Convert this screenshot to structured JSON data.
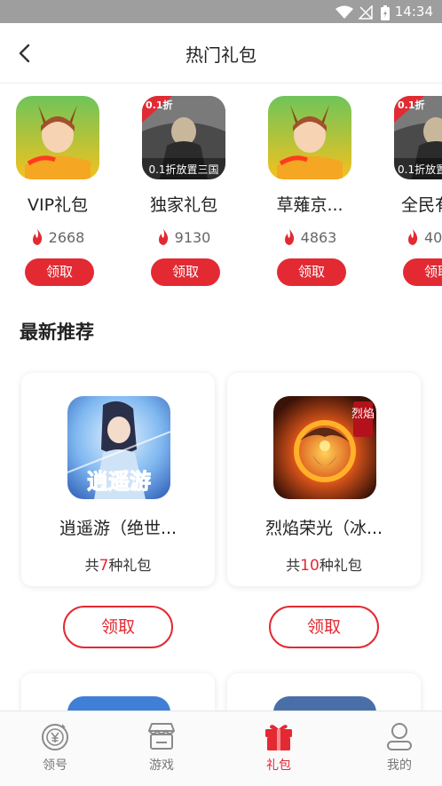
{
  "status_bar": {
    "time": "14:34"
  },
  "header": {
    "title": "热门礼包"
  },
  "hot_gifts": [
    {
      "name": "VIP礼包",
      "count": "2668",
      "button": "领取",
      "icon": "anime-girl-game-icon"
    },
    {
      "name": "独家礼包",
      "count": "9130",
      "button": "领取",
      "icon": "warrior-game-icon",
      "badge": "0.1折",
      "caption": "0.1折放置三国"
    },
    {
      "name": "草薙京...",
      "count": "4863",
      "button": "领取",
      "icon": "anime-girl-game-icon"
    },
    {
      "name": "全民有",
      "count": "40",
      "button": "领取",
      "icon": "warrior-game-icon",
      "badge": "0.1折",
      "caption": "0.1折放置"
    }
  ],
  "latest": {
    "title": "最新推荐",
    "cards": [
      {
        "name": "逍遥游（绝世...",
        "count_prefix": "共",
        "count": "7",
        "count_suffix": "种礼包",
        "button": "领取",
        "icon": "wuxia-game-icon",
        "icon_text": "逍遥游"
      },
      {
        "name": "烈焰荣光（冰...",
        "count_prefix": "共",
        "count": "10",
        "count_suffix": "种礼包",
        "button": "领取",
        "icon": "dragon-game-icon",
        "icon_text": "烈焰"
      }
    ]
  },
  "tabbar": {
    "items": [
      {
        "label": "领号",
        "icon": "coin-icon",
        "active": false
      },
      {
        "label": "游戏",
        "icon": "store-icon",
        "active": false
      },
      {
        "label": "礼包",
        "icon": "gift-icon",
        "active": true
      },
      {
        "label": "我的",
        "icon": "user-icon",
        "active": false
      }
    ]
  },
  "colors": {
    "accent": "#e32a33",
    "statusbar": "#9e9e9e"
  }
}
